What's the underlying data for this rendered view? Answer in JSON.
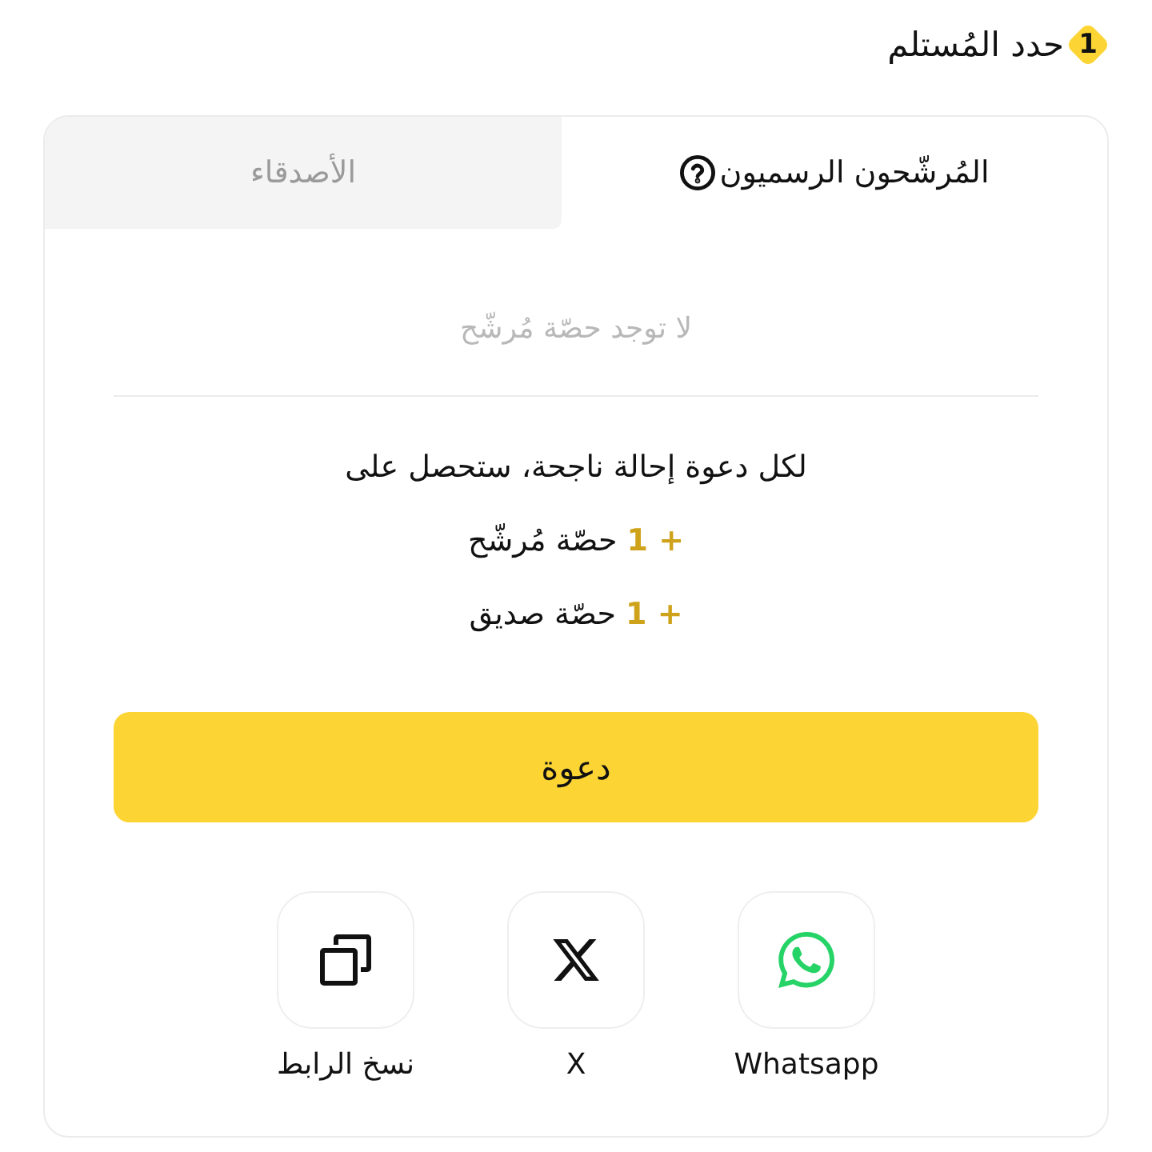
{
  "header": {
    "step": "1",
    "title": "حدد المُستلم"
  },
  "tabs": [
    {
      "label": "المُرشّحون الرسميون",
      "selected": true,
      "help": true
    },
    {
      "label": "الأصدقاء",
      "selected": false,
      "help": false
    }
  ],
  "empty_message": "لا توجد حصّة مُرشّح",
  "reward": {
    "intro": "لكل دعوة إحالة ناجحة، ستحصل على",
    "items": [
      "**+ 1** حصّة مُرشّح",
      "**+ 1** حصّة صديق"
    ]
  },
  "invite_button": "دعوة",
  "share_options": [
    {
      "kind": "whatsapp",
      "label": "Whatsapp"
    },
    {
      "kind": "x",
      "label": "X"
    },
    {
      "kind": "copy",
      "label": "نسخ الرابط"
    }
  ]
}
